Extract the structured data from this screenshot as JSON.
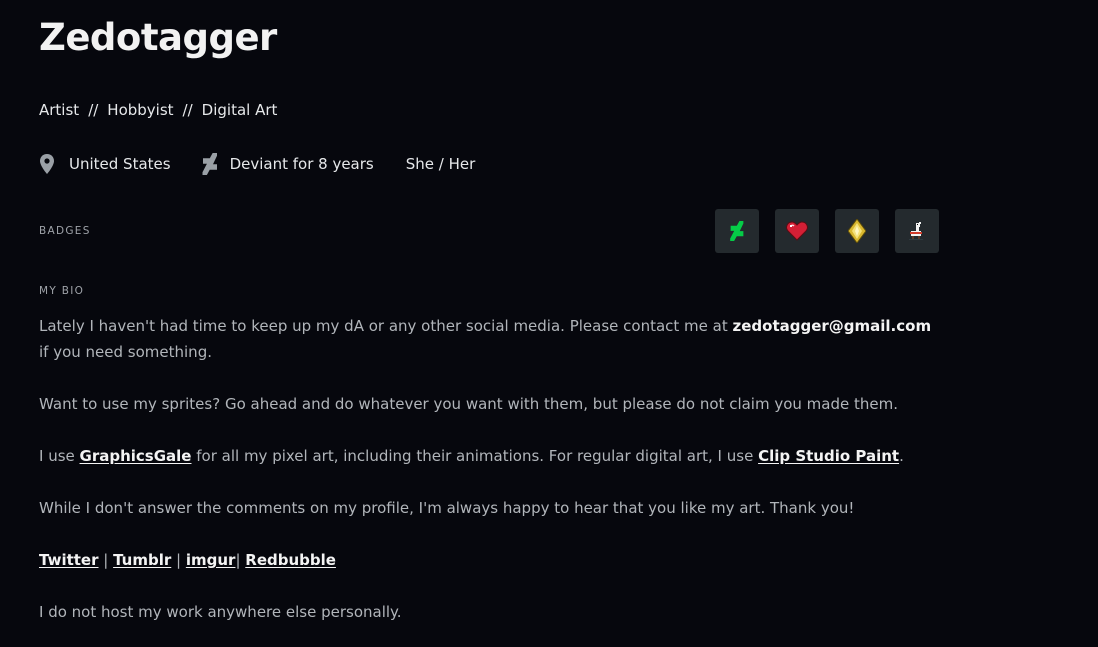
{
  "profile": {
    "name": "Zedotagger",
    "tags": [
      "Artist",
      "Hobbyist",
      "Digital Art"
    ],
    "tag_separator": "//",
    "location": "United States",
    "deviant_since": "Deviant for 8 years",
    "pronouns": "She / Her"
  },
  "badges": {
    "label": "BADGES",
    "items": [
      {
        "icon": "deviantart-logo-badge",
        "color": "#05cc47"
      },
      {
        "icon": "heart-badge",
        "color": "#e5213a"
      },
      {
        "icon": "gem-badge",
        "color": "#e0c23b"
      },
      {
        "icon": "llama-badge",
        "color": "#d23b2a"
      }
    ]
  },
  "bio": {
    "label": "MY BIO",
    "p1_before": "Lately I haven't had time to keep up my dA or any other social media. Please contact me at ",
    "p1_email": "zedotagger@gmail.com",
    "p1_after": " if you need something.",
    "p2": "Want to use my sprites? Go ahead and do whatever you want with them, but please do not claim you made them.",
    "p3_before": "I use ",
    "p3_link1": "GraphicsGale",
    "p3_middle": " for all my pixel art, including their animations. For regular digital art, I use ",
    "p3_link2": "Clip Studio Paint",
    "p3_after": ".",
    "p4": "While I don't answer the comments on my profile, I'm always happy to hear that you like my art. Thank you!",
    "links": {
      "twitter": "Twitter",
      "tumblr": "Tumblr",
      "imgur": "imgur",
      "redbubble": "Redbubble",
      "sep1": " | ",
      "sep2": " | ",
      "sep3": "| "
    },
    "p6": "I do not host my work anywhere else personally."
  },
  "colors": {
    "background": "#06070d",
    "text": "#e6e8ea",
    "muted": "#b1b5ba",
    "badge_bg": "#242a2e"
  }
}
